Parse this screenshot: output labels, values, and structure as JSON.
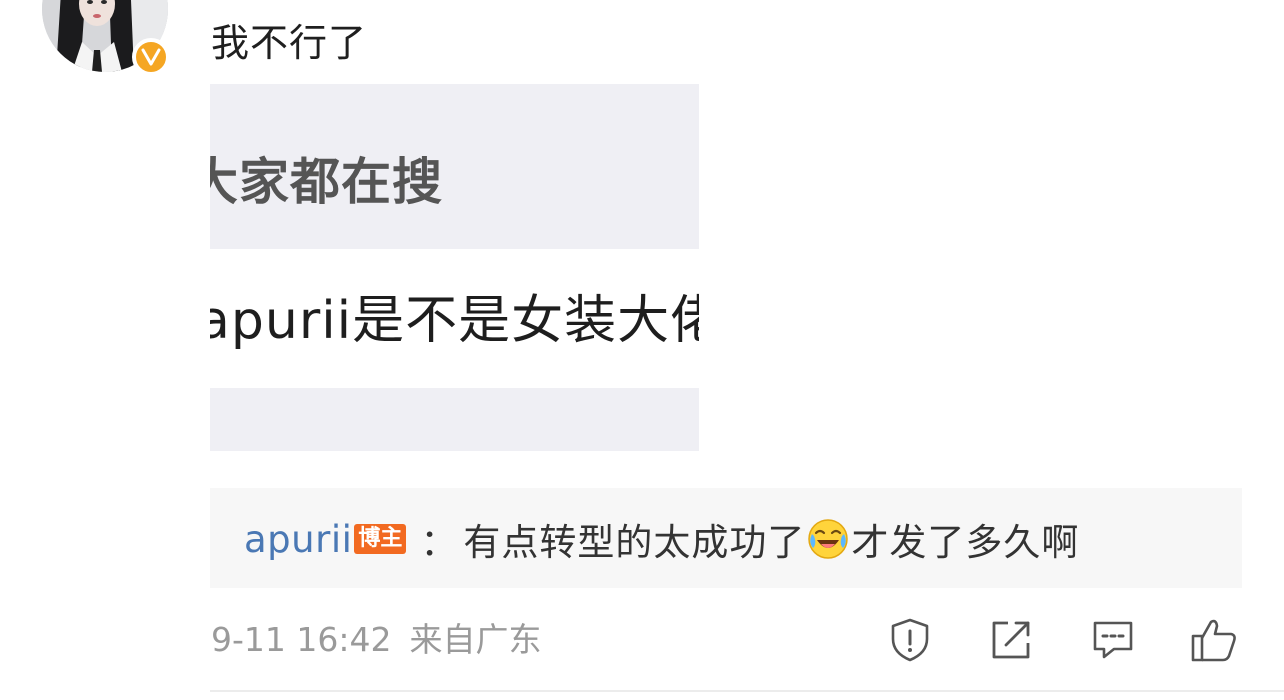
{
  "post": {
    "author_avatar": "avatar",
    "verified_badge_label": "V",
    "text": "我不行了",
    "image": {
      "line1": "大家都在搜",
      "line2": "apurii是不是女装大佬"
    }
  },
  "reply": {
    "author": "apurii",
    "tag": "博主",
    "colon": "：",
    "text_before_emoji": "有点转型的太成功了",
    "emoji": "laugh-cry-emoji",
    "text_after_emoji": "才发了多久啊"
  },
  "meta": {
    "datetime": "9-11 16:42",
    "source": "来自广东"
  },
  "actions": {
    "report_icon": "shield-exclamation-icon",
    "repost_icon": "share-icon",
    "comment_icon": "comment-icon",
    "like_icon": "thumbs-up-icon"
  },
  "colors": {
    "link_blue": "#4a78b4",
    "tag_orange": "#f26a21",
    "badge_gold": "#f5a623",
    "meta_gray": "#9a9a9a"
  }
}
